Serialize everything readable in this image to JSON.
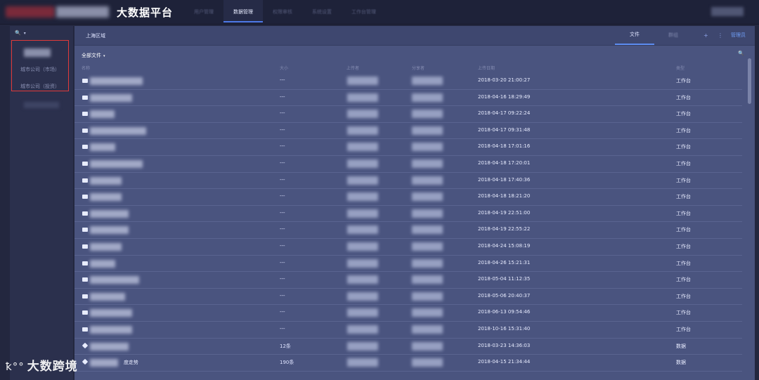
{
  "topbar": {
    "brand": "大数据平台",
    "nav": [
      {
        "label": "用户管理",
        "active": false
      },
      {
        "label": "数据管理",
        "active": true
      },
      {
        "label": "权限审核",
        "active": false
      },
      {
        "label": "系统设置",
        "active": false
      },
      {
        "label": "工作台管理",
        "active": false
      }
    ]
  },
  "sidebar": {
    "search_icon": "🔍",
    "caret": "▾",
    "items": [
      "城市公司（市场）",
      "城市公司（投资）"
    ]
  },
  "main": {
    "region": "上海区域",
    "tabs": {
      "file": "文件",
      "other": "群组"
    },
    "plus": "+",
    "sep": "⋮",
    "admin": "管理员",
    "all_files": "全部文件",
    "caret": "▾",
    "search_icon": "🔍",
    "columns": {
      "name": "名称",
      "size": "大小",
      "uploader": "上传者",
      "sharer": "分享者",
      "time": "上传日期",
      "type": "类型"
    },
    "rows": [
      {
        "icon": "file",
        "size": "---",
        "time": "2018-03-20 21:00:27",
        "type": "工作台",
        "blur": 75
      },
      {
        "icon": "file",
        "size": "---",
        "time": "2018-04-16 18:29:49",
        "type": "工作台",
        "blur": 60
      },
      {
        "icon": "file",
        "size": "---",
        "time": "2018-04-17 09:22:24",
        "type": "工作台",
        "blur": 35
      },
      {
        "icon": "file",
        "size": "---",
        "time": "2018-04-17 09:31:48",
        "type": "工作台",
        "blur": 80
      },
      {
        "icon": "file",
        "size": "---",
        "time": "2018-04-18 17:01:16",
        "type": "工作台",
        "blur": 36
      },
      {
        "icon": "file",
        "size": "---",
        "time": "2018-04-18 17:20:01",
        "type": "工作台",
        "blur": 75
      },
      {
        "icon": "file",
        "size": "---",
        "time": "2018-04-18 17:40:36",
        "type": "工作台",
        "blur": 45
      },
      {
        "icon": "file",
        "size": "---",
        "time": "2018-04-18 18:21:20",
        "type": "工作台",
        "blur": 45
      },
      {
        "icon": "file",
        "size": "---",
        "time": "2018-04-19 22:51:00",
        "type": "工作台",
        "blur": 55
      },
      {
        "icon": "file",
        "size": "---",
        "time": "2018-04-19 22:55:22",
        "type": "工作台",
        "blur": 55
      },
      {
        "icon": "file",
        "size": "---",
        "time": "2018-04-24 15:08:19",
        "type": "工作台",
        "blur": 45
      },
      {
        "icon": "file",
        "size": "---",
        "time": "2018-04-26 15:21:31",
        "type": "工作台",
        "blur": 36
      },
      {
        "icon": "file",
        "size": "---",
        "time": "2018-05-04 11:12:35",
        "type": "工作台",
        "blur": 70
      },
      {
        "icon": "file",
        "size": "---",
        "time": "2018-05-06 20:40:37",
        "type": "工作台",
        "blur": 50
      },
      {
        "icon": "file",
        "size": "---",
        "time": "2018-06-13 09:54:46",
        "type": "工作台",
        "blur": 60
      },
      {
        "icon": "file",
        "size": "---",
        "time": "2018-10-16 15:31:40",
        "type": "工作台",
        "blur": 60
      },
      {
        "icon": "db",
        "size": "12条",
        "time": "2018-03-23 14:36:03",
        "type": "数据",
        "blur": 55
      },
      {
        "icon": "db",
        "size": "190条",
        "time": "2018-04-15 21:34:44",
        "type": "数据",
        "blur": 40,
        "name_suffix": "度走势"
      }
    ]
  },
  "watermark": {
    "logo": "ꝁ°°",
    "text": "大数跨境"
  }
}
